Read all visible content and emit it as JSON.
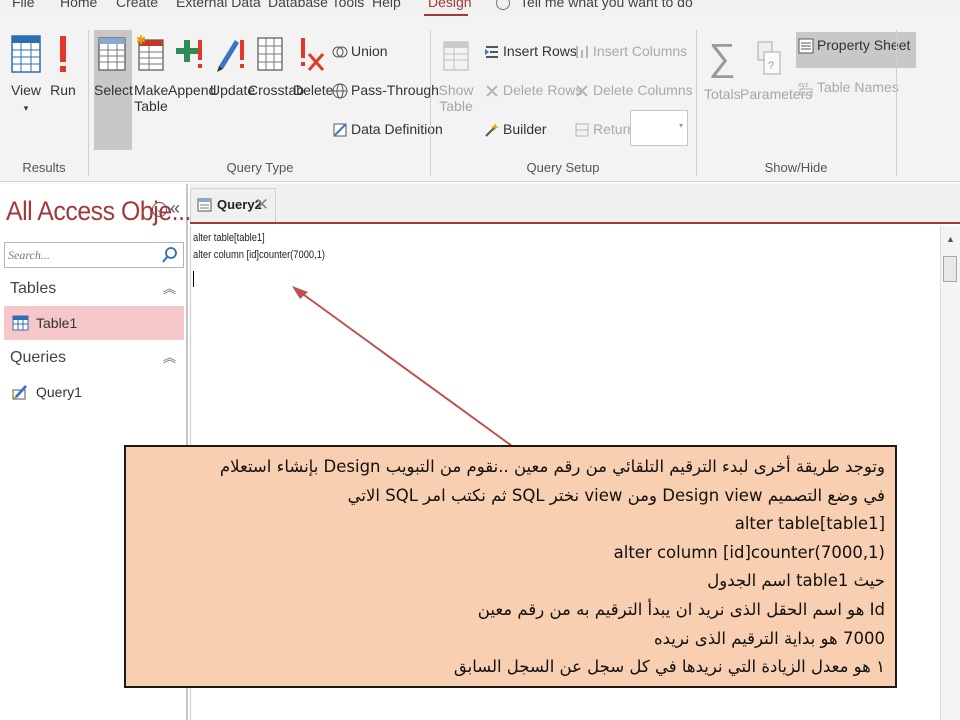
{
  "tabs": [
    {
      "label": "File",
      "active": false
    },
    {
      "label": "Home",
      "active": false
    },
    {
      "label": "Create",
      "active": false
    },
    {
      "label": "External Data",
      "active": false
    },
    {
      "label": "Database Tools",
      "active": false
    },
    {
      "label": "Help",
      "active": false
    },
    {
      "label": "Design",
      "active": true
    }
  ],
  "tell_me": "Tell me what you want to do",
  "ribbon": {
    "results": {
      "label": "Results",
      "view": "View",
      "run": "Run"
    },
    "query_type": {
      "label": "Query Type",
      "select": "Select",
      "make_table_1": "Make",
      "make_table_2": "Table",
      "append": "Append",
      "update": "Update",
      "crosstab": "Crosstab",
      "delete": "Delete",
      "union": "Union",
      "pass_through": "Pass-Through",
      "data_definition": "Data Definition"
    },
    "query_setup": {
      "label": "Query Setup",
      "show_table_1": "Show",
      "show_table_2": "Table",
      "insert_rows": "Insert Rows",
      "delete_rows": "Delete Rows",
      "builder": "Builder",
      "insert_columns": "Insert Columns",
      "delete_columns": "Delete Columns",
      "return_label": "Return:",
      "return_value": ""
    },
    "show_hide": {
      "label": "Show/Hide",
      "totals": "Totals",
      "parameters": "Parameters",
      "property_sheet": "Property Sheet",
      "table_names": "Table Names"
    }
  },
  "nav": {
    "title": "All Access Obje...",
    "search_placeholder": "Search...",
    "sections": [
      {
        "label": "Tables",
        "items": [
          "Table1"
        ]
      },
      {
        "label": "Queries",
        "items": [
          "Query1"
        ]
      }
    ]
  },
  "document": {
    "tab_label": "Query2",
    "sql_lines": [
      "alter table[table1]",
      "alter column [id]counter(7000,1)"
    ]
  },
  "callout": {
    "lines": [
      "وتوجد طريقة أخرى لبدء الترقيم التلقائي من رقم معين ..نقوم من التبويب Design بإنشاء استعلام",
      "في وضع التصميم Design view ومن view نختر SQL ثم نكتب امر  SQL الاتي",
      "alter table[table1]",
      "alter column [id]counter(7000,1)",
      "حيث table1 اسم الجدول",
      "Id هو اسم الحقل الذى نريد ان يبدأ الترقيم به من رقم معين",
      "7000 هو بداية الترقيم الذى نريده",
      "١ هو معدل الزيادة التي نريدها في كل سجل عن السجل السابق"
    ]
  },
  "colors": {
    "accent": "#a4373a",
    "callout_bg": "#f9cfb1",
    "nav_selected": "#f6c7c8"
  }
}
